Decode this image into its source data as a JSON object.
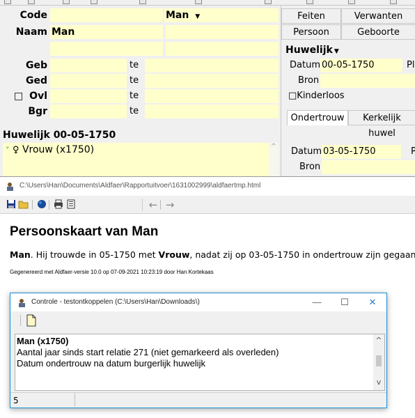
{
  "top_panel": {
    "code_label": "Code",
    "code_value": "",
    "man_dropdown": "Man",
    "naam_label": "Naam",
    "naam_value": "Man",
    "geb_label": "Geb",
    "ged_label": "Ged",
    "ovl_label": "Ovl",
    "bgr_label": "Bgr",
    "te_label": "te",
    "huwelijk_title": "Huwelijk 00-05-1750",
    "huwelijk_partner": "Vrouw (x1750)"
  },
  "right_panel": {
    "tabs_row1": [
      "Feiten",
      "Verwanten"
    ],
    "tabs_row2": [
      "Persoon",
      "Geboorte"
    ],
    "section_title": "Huwelijk",
    "datum_label": "Datum",
    "datum_value": "00-05-1750",
    "pl_label": "Pl",
    "bron_label": "Bron",
    "kinderloos_label": "Kinderloos",
    "subtabs": [
      "Ondertrouw",
      "Kerkelijk huwel"
    ],
    "datum2_label": "Datum",
    "datum2_value": "03-05-1750",
    "p_label": "P",
    "bron2_label": "Bron"
  },
  "browser": {
    "title": "C:\\Users\\Han\\Documents\\Aldfaer\\Rapportuitvoer\\1631002999\\aldfaertmp.html",
    "heading": "Persoonskaart van Man",
    "line_bold1": "Man",
    "line_part1": ". Hij trouwde in 05-1750 met ",
    "line_bold2": "Vrouw",
    "line_part2": ", nadat zij op 03-05-1750 in ondertrouw zijn gegaan.",
    "generated": "Gegenereerd met Aldfaer-versie 10.0 op 07-09-2021 10:23:19 door Han Kortekaas"
  },
  "dialog": {
    "title": "Controle - testontkoppelen (C:\\Users\\Han\\Downloads\\)",
    "line1": "Man (x1750)",
    "line2": "Aantal jaar sinds start relatie 271 (niet gemarkeerd als overleden)",
    "line3": "Datum ondertrouw na datum burgerlijk huwelijk",
    "status_count": "5"
  },
  "icons": {
    "dropdown": "▼",
    "checkbox": "□",
    "min": "—",
    "max": "☐",
    "close": "✕",
    "scroll_up": "^",
    "scroll_down": "v",
    "back": "←",
    "forward": "→"
  }
}
